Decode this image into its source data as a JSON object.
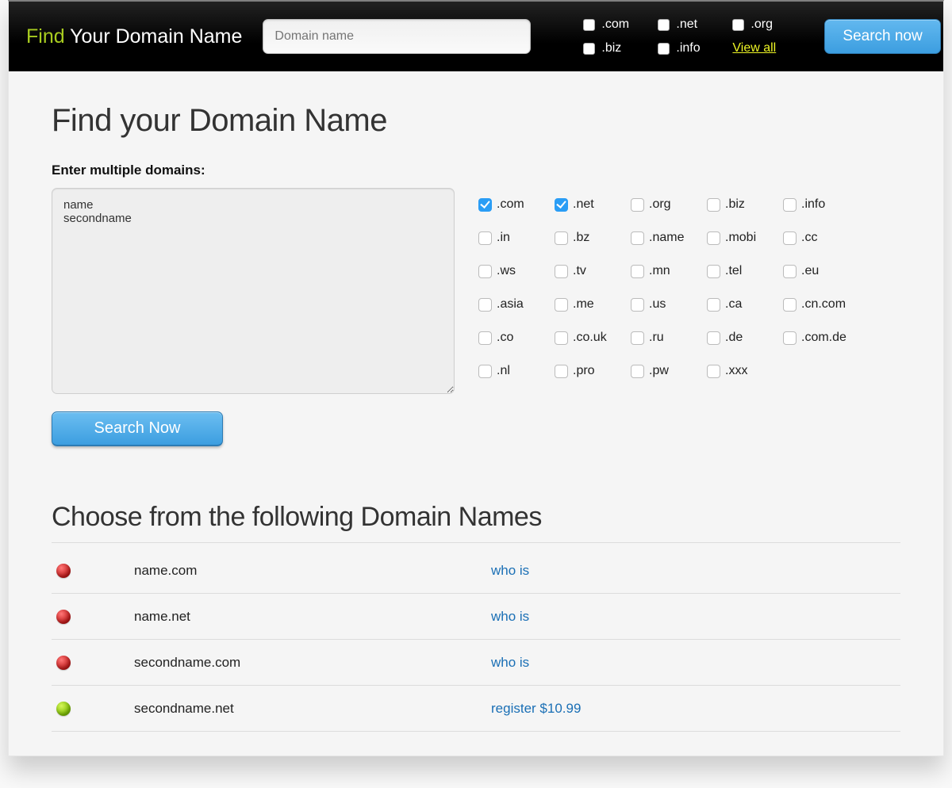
{
  "brand": {
    "find": "Find",
    "rest": "Your Domain Name"
  },
  "top_search": {
    "placeholder": "Domain name",
    "value": ""
  },
  "top_tlds": [
    {
      "label": ".com"
    },
    {
      "label": ".net"
    },
    {
      "label": ".org"
    },
    {
      "label": ".biz"
    },
    {
      "label": ".info"
    }
  ],
  "view_all_label": "View all",
  "search_now_top": "Search now",
  "page_title": "Find your Domain Name",
  "multi_label": "Enter multiple domains:",
  "multi_value": "name\nsecondname",
  "tlds": [
    {
      "label": ".com",
      "checked": true
    },
    {
      "label": ".net",
      "checked": true
    },
    {
      "label": ".org",
      "checked": false
    },
    {
      "label": ".biz",
      "checked": false
    },
    {
      "label": ".info",
      "checked": false
    },
    {
      "label": ".in",
      "checked": false
    },
    {
      "label": ".bz",
      "checked": false
    },
    {
      "label": ".name",
      "checked": false
    },
    {
      "label": ".mobi",
      "checked": false
    },
    {
      "label": ".cc",
      "checked": false
    },
    {
      "label": ".ws",
      "checked": false
    },
    {
      "label": ".tv",
      "checked": false
    },
    {
      "label": ".mn",
      "checked": false
    },
    {
      "label": ".tel",
      "checked": false
    },
    {
      "label": ".eu",
      "checked": false
    },
    {
      "label": ".asia",
      "checked": false
    },
    {
      "label": ".me",
      "checked": false
    },
    {
      "label": ".us",
      "checked": false
    },
    {
      "label": ".ca",
      "checked": false
    },
    {
      "label": ".cn.com",
      "checked": false
    },
    {
      "label": ".co",
      "checked": false
    },
    {
      "label": ".co.uk",
      "checked": false
    },
    {
      "label": ".ru",
      "checked": false
    },
    {
      "label": ".de",
      "checked": false
    },
    {
      "label": ".com.de",
      "checked": false
    },
    {
      "label": ".nl",
      "checked": false
    },
    {
      "label": ".pro",
      "checked": false
    },
    {
      "label": ".pw",
      "checked": false
    },
    {
      "label": ".xxx",
      "checked": false
    }
  ],
  "search_now_main": "Search Now",
  "results_title": "Choose from the following Domain Names",
  "results": [
    {
      "status": "red",
      "domain": "name.com",
      "action": "who is"
    },
    {
      "status": "red",
      "domain": "name.net",
      "action": "who is"
    },
    {
      "status": "red",
      "domain": "secondname.com",
      "action": "who is"
    },
    {
      "status": "green",
      "domain": "secondname.net",
      "action": "register $10.99"
    }
  ]
}
